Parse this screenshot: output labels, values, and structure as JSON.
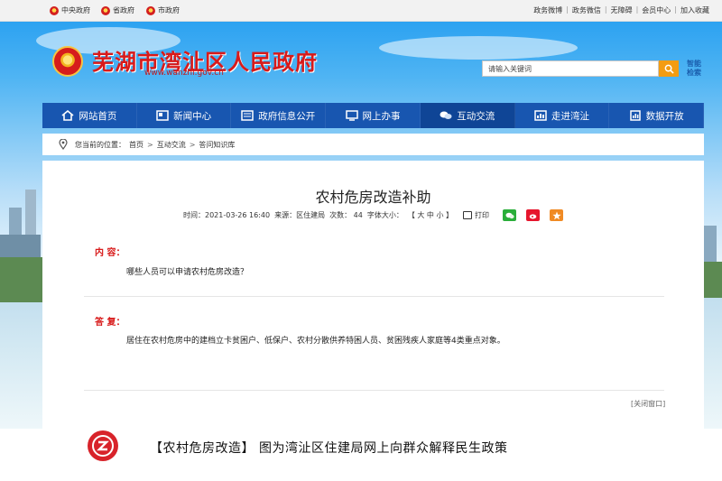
{
  "topbar": {
    "links": [
      {
        "label": "中央政府",
        "icon": "national-emblem-icon"
      },
      {
        "label": "省政府",
        "icon": "national-emblem-icon"
      },
      {
        "label": "市政府",
        "icon": "national-emblem-icon"
      }
    ],
    "right_links": [
      "政务微博",
      "政务微信",
      "无障碍",
      "会员中心",
      "加入收藏"
    ]
  },
  "header": {
    "title": "芜湖市湾沚区人民政府",
    "url": "www.wanzhi.gov.cn",
    "search_placeholder": "请输入关键词",
    "smart_search": "智能检索"
  },
  "nav": {
    "items": [
      {
        "label": "网站首页",
        "icon": "home-icon"
      },
      {
        "label": "新闻中心",
        "icon": "news-icon"
      },
      {
        "label": "政府信息公开",
        "icon": "info-disclosure-icon"
      },
      {
        "label": "网上办事",
        "icon": "monitor-icon"
      },
      {
        "label": "互动交流",
        "icon": "chat-bubbles-icon",
        "active": true
      },
      {
        "label": "走进湾沚",
        "icon": "chart-board-icon"
      },
      {
        "label": "数据开放",
        "icon": "document-data-icon"
      }
    ]
  },
  "breadcrumb": {
    "prefix": "您当前的位置：",
    "items": [
      "首页",
      "互动交流",
      "答问知识库"
    ],
    "separator": ">"
  },
  "article": {
    "title": "农村危房改造补助",
    "time": "时间：2021-03-26 16:40",
    "source": "来源：区住建局",
    "views": "次数： 44",
    "font_size_label": "字体大小：",
    "font_sizes": "【 大 中 小 】",
    "print_label": "打印",
    "share_icons": [
      "wechat-icon",
      "weibo-icon",
      "favorite-star-icon"
    ],
    "content_label": "内 容：",
    "content_text": "哪些人员可以申请农村危房改造？",
    "reply_label": "答 复：",
    "reply_text": "居住在农村危房中的建档立卡贫困户、低保户、农村分散供养特困人员、贫困残疾人家庭等4类重点对象。",
    "close_label": "[关闭窗口]"
  },
  "caption": {
    "text": "【农村危房改造】 图为湾沚区住建局网上向群众解释民生政策"
  },
  "colors": {
    "nav_blue": "#1856b0",
    "title_red": "#d81a1a",
    "search_orange": "#f39c12",
    "wechat_green": "#2aae3a",
    "weibo_red": "#e6162d",
    "star_orange": "#f08a24"
  }
}
